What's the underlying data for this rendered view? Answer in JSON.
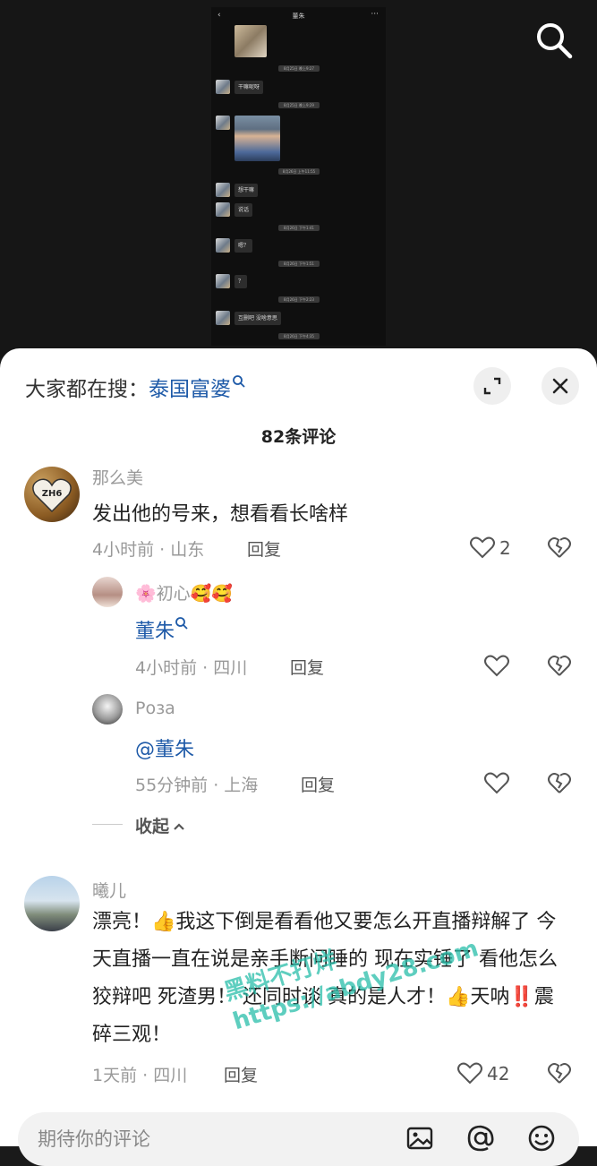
{
  "shot": {
    "title": "董朱",
    "back": "‹",
    "more": "···",
    "times": [
      "8月25日 晚上9:27",
      "8月25日 晚上9:29",
      "8月26日 上午11:55",
      "8月26日 下午1:41",
      "8月26日 下午1:51",
      "8月26日 下午2:23",
      "8月26日 下午4:35"
    ],
    "messages": [
      "干嘛呢呀",
      "想干嘛",
      "说话",
      "嗯？",
      "？",
      "互删吧 没啥意思"
    ]
  },
  "sheet": {
    "hot_prefix": "大家都在搜：",
    "hot_keyword": "泰国富婆",
    "count": "82条评论",
    "comments": [
      {
        "name": "那么美",
        "text": "发出他的号来，想看看长啥样",
        "meta": "4小时前 · 山东",
        "reply": "回复",
        "likes": "2",
        "avatar_text": "ZH6",
        "replies": [
          {
            "name": "🌸初心🥰🥰",
            "text": "董朱",
            "meta": "4小时前 · 四川",
            "reply": "回复"
          },
          {
            "name": "Роза",
            "text": "@董朱",
            "meta": "55分钟前 · 上海",
            "reply": "回复"
          }
        ],
        "collapse": "收起"
      },
      {
        "name": "曦儿",
        "text_parts": [
          "漂亮！",
          "👍",
          "我这下倒是看看他又要怎么开直播辩解了 今天直播一直在说是亲手断问睡的 现在实锤了 看他怎么狡辩吧 死渣男！ 还同时谈 真的是人才！",
          "👍",
          "天呐",
          "‼️",
          "震碎三观！"
        ],
        "meta": "1天前 · 四川",
        "reply": "回复",
        "likes": "42"
      }
    ],
    "input_placeholder": "期待你的评论"
  },
  "watermark": [
    "黑料不打烊",
    "https://abdy28.com"
  ],
  "colors": {
    "link": "#1e5aa8",
    "watermark": "#28bea9"
  }
}
